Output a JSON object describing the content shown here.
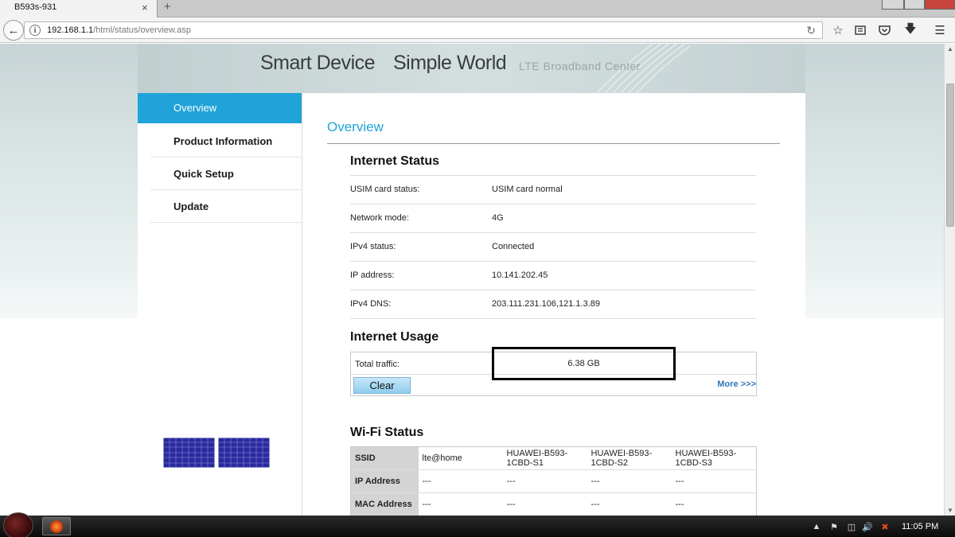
{
  "browser": {
    "tab_title": "B593s-931",
    "tab_close": "×",
    "new_tab": "+",
    "url_host": "192.168.1.1",
    "url_path": "/html/status/overview.asp"
  },
  "header": {
    "slogan_1": "Smart Device",
    "slogan_2": "Simple World",
    "slogan_3": "LTE Broadband Center"
  },
  "sidebar": {
    "items": [
      {
        "label": "Overview",
        "active": true
      },
      {
        "label": "Product Information",
        "active": false
      },
      {
        "label": "Quick Setup",
        "active": false
      },
      {
        "label": "Update",
        "active": false
      }
    ]
  },
  "main": {
    "heading": "Overview",
    "internet_status": {
      "title": "Internet Status",
      "rows": [
        {
          "label": "USIM card status:",
          "value": "USIM card normal"
        },
        {
          "label": "Network mode:",
          "value": "4G"
        },
        {
          "label": "IPv4 status:",
          "value": "Connected"
        },
        {
          "label": "IP address:",
          "value": "10.141.202.45"
        },
        {
          "label": "IPv4 DNS:",
          "value": "203.111.231.106,121.1.3.89"
        }
      ]
    },
    "internet_usage": {
      "title": "Internet Usage",
      "total_traffic_label": "Total traffic:",
      "total_traffic_value": "6.38 GB",
      "clear_label": "Clear",
      "more_label": "More >>>"
    },
    "wifi_status": {
      "title": "Wi-Fi Status",
      "rows": [
        {
          "label": "SSID",
          "values": [
            "lte@home",
            "HUAWEI-B593-1CBD-S1",
            "HUAWEI-B593-1CBD-S2",
            "HUAWEI-B593-1CBD-S3"
          ]
        },
        {
          "label": "IP Address",
          "values": [
            "---",
            "---",
            "---",
            "---"
          ]
        },
        {
          "label": "MAC Address",
          "values": [
            "---",
            "---",
            "---",
            "---"
          ]
        }
      ]
    }
  },
  "taskbar": {
    "clock": "11:05 PM"
  },
  "colors": {
    "accent": "#1fa3d8",
    "link": "#2d74b8",
    "logo_blue": "#2a2a9e"
  }
}
